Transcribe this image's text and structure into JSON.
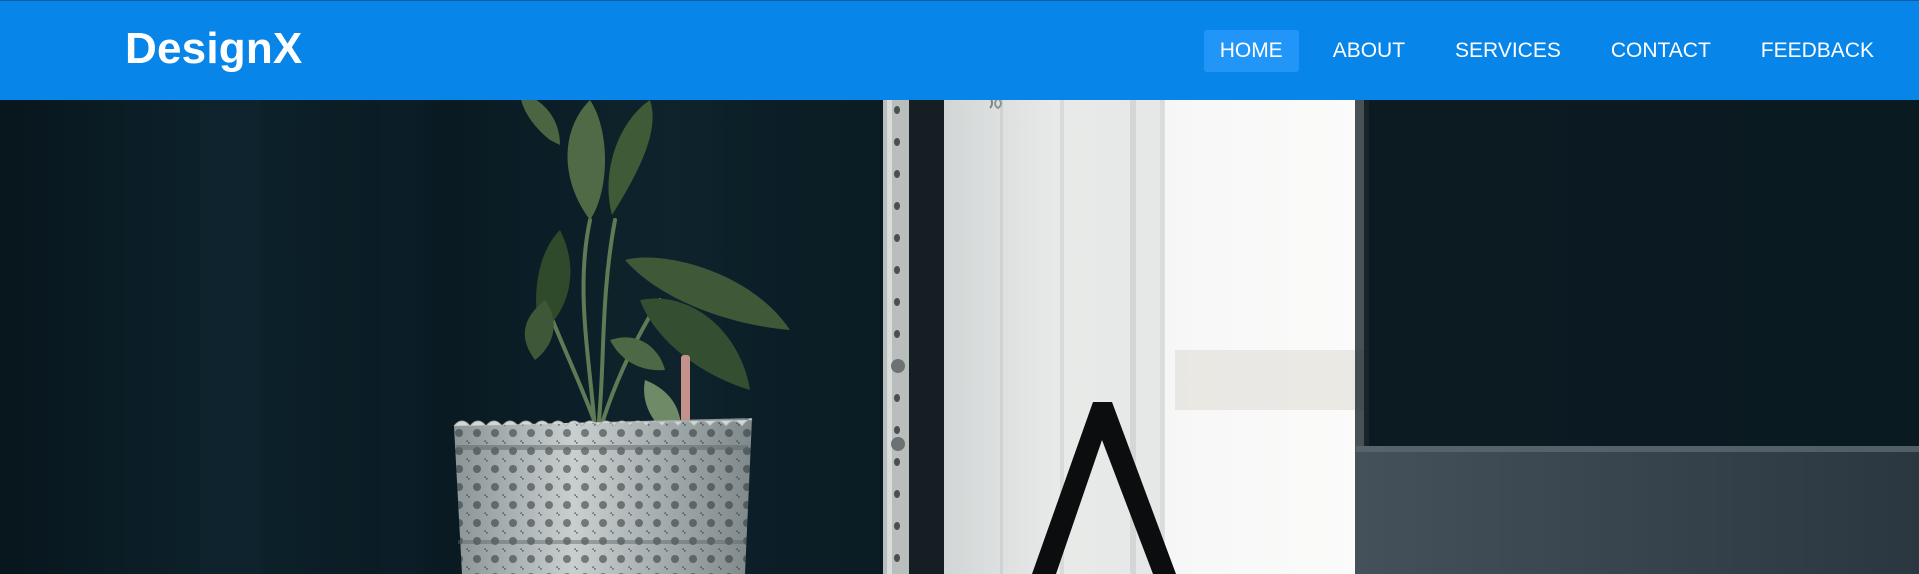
{
  "brand": {
    "name": "DesignX"
  },
  "nav": {
    "items": [
      {
        "label": "HOME",
        "active": true
      },
      {
        "label": "ABOUT",
        "active": false
      },
      {
        "label": "SERVICES",
        "active": false
      },
      {
        "label": "CONTACT",
        "active": false
      },
      {
        "label": "FEEDBACK",
        "active": false
      }
    ]
  },
  "colors": {
    "navbar": "#0785e8",
    "nav_active": "#2196f8",
    "text": "#ffffff",
    "hero_dark": "#0a1c24"
  },
  "hero": {
    "image": "desk-plant-photo"
  }
}
